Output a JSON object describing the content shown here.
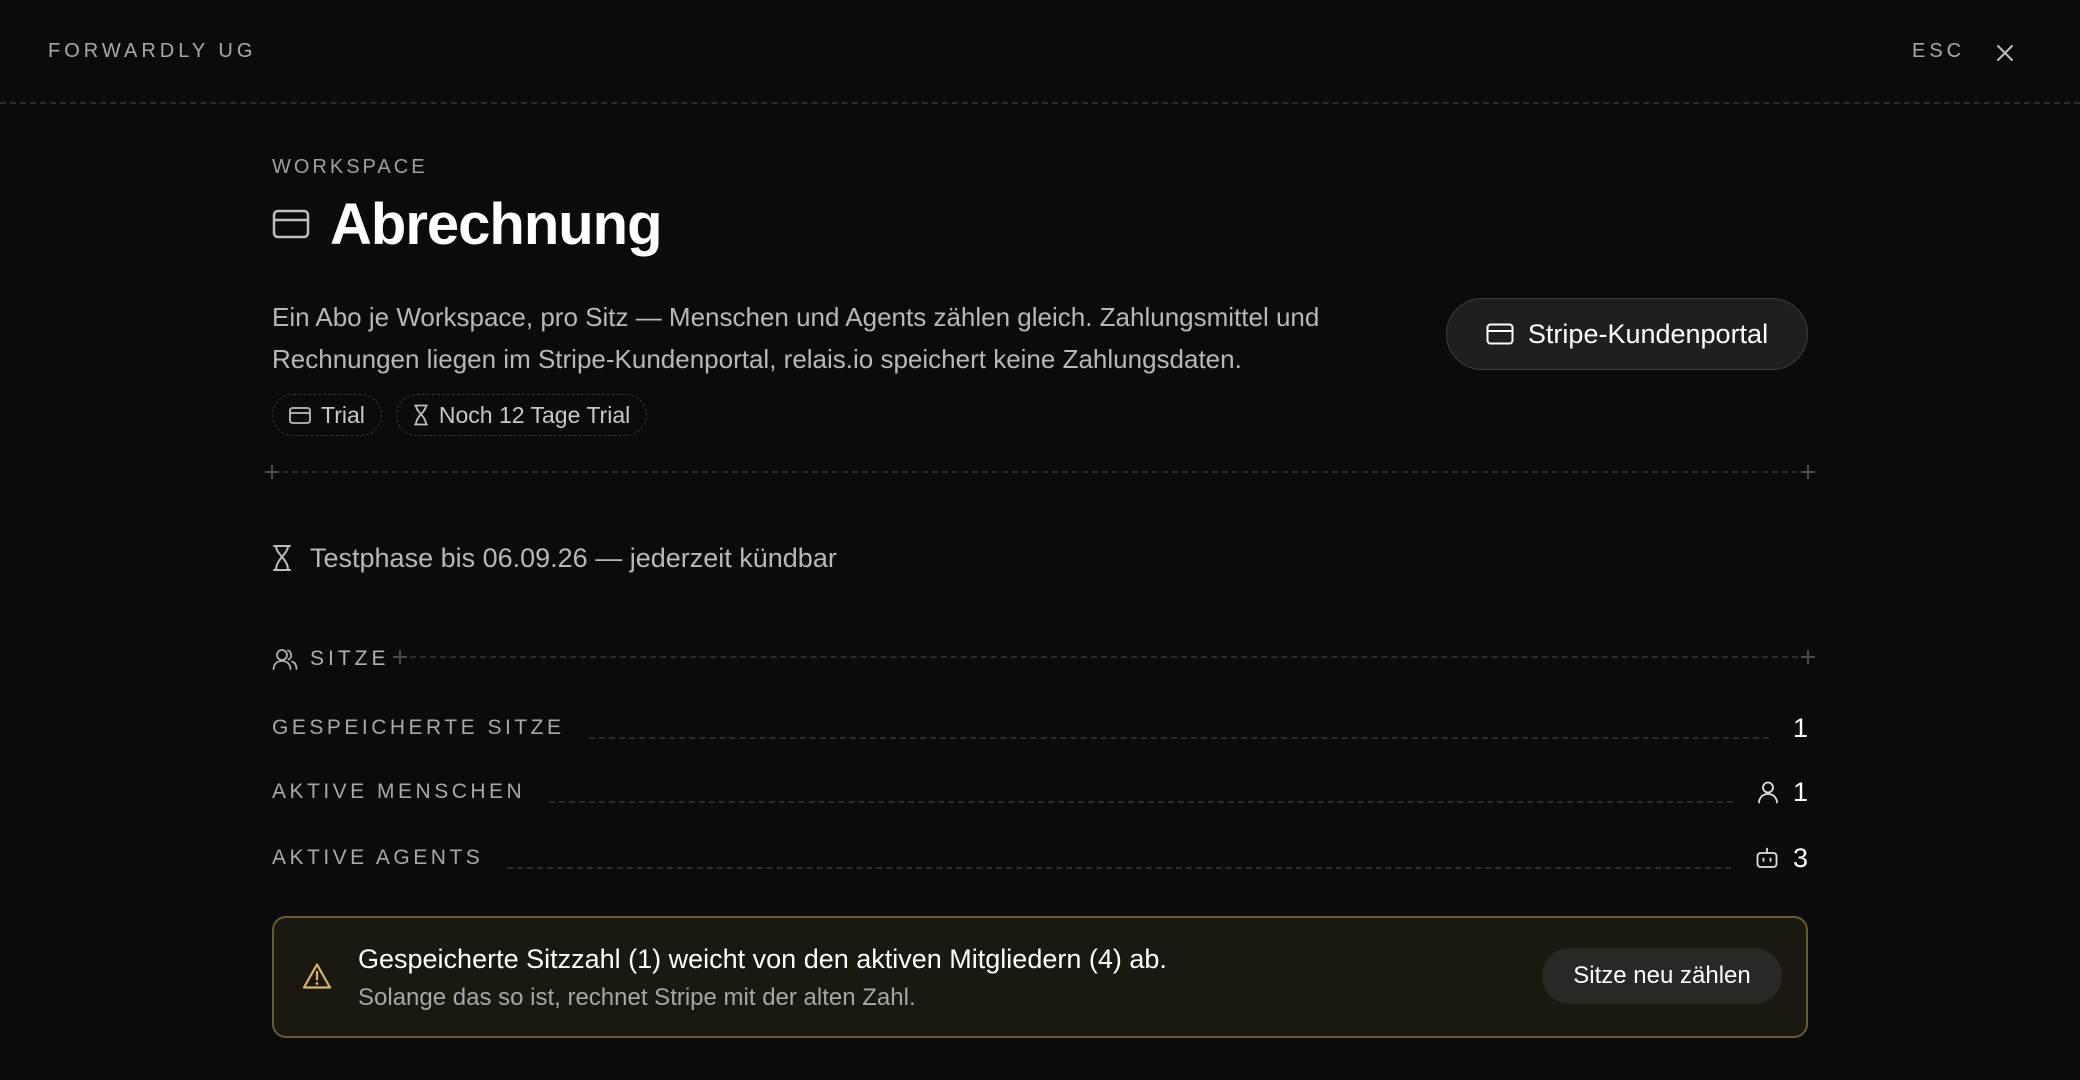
{
  "header": {
    "brand": "FORWARDLY UG",
    "esc_label": "ESC"
  },
  "page": {
    "eyebrow": "WORKSPACE",
    "title": "Abrechnung",
    "description_line1": "Ein Abo je Workspace, pro Sitz — Menschen und Agents zählen gleich. Zahlungsmittel und",
    "description_line2": "Rechnungen liegen im Stripe-Kundenportal, relais.io speichert keine Zahlungsdaten.",
    "portal_button": "Stripe-Kundenportal"
  },
  "chips": [
    {
      "label": "Trial",
      "icon": "credit-card-icon"
    },
    {
      "label": "Noch 12 Tage Trial",
      "icon": "hourglass-icon"
    }
  ],
  "trial_notice": "Testphase bis 06.09.26 — jederzeit kündbar",
  "seats": {
    "section_label": "SITZE",
    "rows": [
      {
        "label": "GESPEICHERTE SITZE",
        "value": "1",
        "icon": ""
      },
      {
        "label": "AKTIVE MENSCHEN",
        "value": "1",
        "icon": "user-icon"
      },
      {
        "label": "AKTIVE AGENTS",
        "value": "3",
        "icon": "bot-icon"
      }
    ]
  },
  "alert": {
    "title": "Gespeicherte Sitzzahl (1) weicht von den aktiven Mitgliedern (4) ab.",
    "subtitle": "Solange das so ist, rechnet Stripe mit der alten Zahl.",
    "button": "Sitze neu zählen"
  },
  "colors": {
    "background": "#0b0b0b",
    "alert_border": "#6b5833",
    "alert_icon": "#d9b36a"
  }
}
